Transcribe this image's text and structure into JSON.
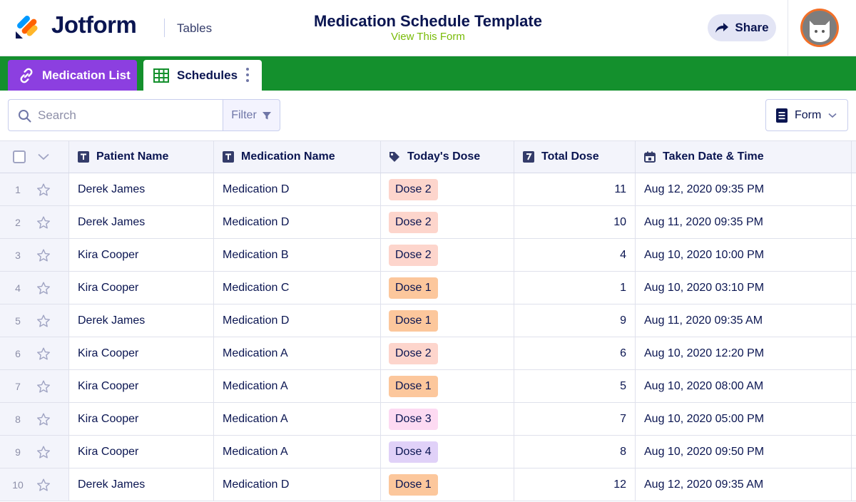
{
  "header": {
    "brand": "Jotform",
    "section": "Tables",
    "title": "Medication Schedule Template",
    "view_form": "View This Form",
    "share_label": "Share"
  },
  "tabs": [
    {
      "label": "Medication List",
      "icon": "link-icon",
      "color": "#8c3fe0"
    },
    {
      "label": "Schedules",
      "icon": "table-grid-icon",
      "active": true
    }
  ],
  "tabbar_color": "#14902d",
  "toolbar": {
    "search_placeholder": "Search",
    "filter_label": "Filter",
    "form_label": "Form"
  },
  "columns": [
    {
      "label": "Patient Name",
      "icon": "text-type-icon"
    },
    {
      "label": "Medication Name",
      "icon": "text-type-icon"
    },
    {
      "label": "Today's Dose",
      "icon": "tag-icon"
    },
    {
      "label": "Total Dose",
      "icon": "number-type-icon"
    },
    {
      "label": "Taken Date & Time",
      "icon": "calendar-icon"
    }
  ],
  "dose_colors": {
    "Dose 1": "#fcc79c",
    "Dose 2": "#fdd5cc",
    "Dose 3": "#fddaf2",
    "Dose 4": "#e0d1f8"
  },
  "rows": [
    {
      "num": "1",
      "patient": "Derek James",
      "medication": "Medication D",
      "dose": "Dose 2",
      "total": "11",
      "date": "Aug 12, 2020 09:35 PM"
    },
    {
      "num": "2",
      "patient": "Derek James",
      "medication": "Medication D",
      "dose": "Dose 2",
      "total": "10",
      "date": "Aug 11, 2020 09:35 PM"
    },
    {
      "num": "3",
      "patient": "Kira Cooper",
      "medication": "Medication B",
      "dose": "Dose 2",
      "total": "4",
      "date": "Aug 10, 2020 10:00 PM"
    },
    {
      "num": "4",
      "patient": "Kira Cooper",
      "medication": "Medication C",
      "dose": "Dose 1",
      "total": "1",
      "date": "Aug 10, 2020 03:10 PM"
    },
    {
      "num": "5",
      "patient": "Derek James",
      "medication": "Medication D",
      "dose": "Dose 1",
      "total": "9",
      "date": "Aug 11, 2020 09:35 AM"
    },
    {
      "num": "6",
      "patient": "Kira Cooper",
      "medication": "Medication A",
      "dose": "Dose 2",
      "total": "6",
      "date": "Aug 10, 2020 12:20 PM"
    },
    {
      "num": "7",
      "patient": "Kira Cooper",
      "medication": "Medication A",
      "dose": "Dose 1",
      "total": "5",
      "date": "Aug 10, 2020 08:00 AM"
    },
    {
      "num": "8",
      "patient": "Kira Cooper",
      "medication": "Medication A",
      "dose": "Dose 3",
      "total": "7",
      "date": "Aug 10, 2020 05:00 PM"
    },
    {
      "num": "9",
      "patient": "Kira Cooper",
      "medication": "Medication A",
      "dose": "Dose 4",
      "total": "8",
      "date": "Aug 10, 2020 09:50 PM"
    },
    {
      "num": "10",
      "patient": "Derek James",
      "medication": "Medication D",
      "dose": "Dose 1",
      "total": "12",
      "date": "Aug 12, 2020 09:35 AM"
    }
  ]
}
